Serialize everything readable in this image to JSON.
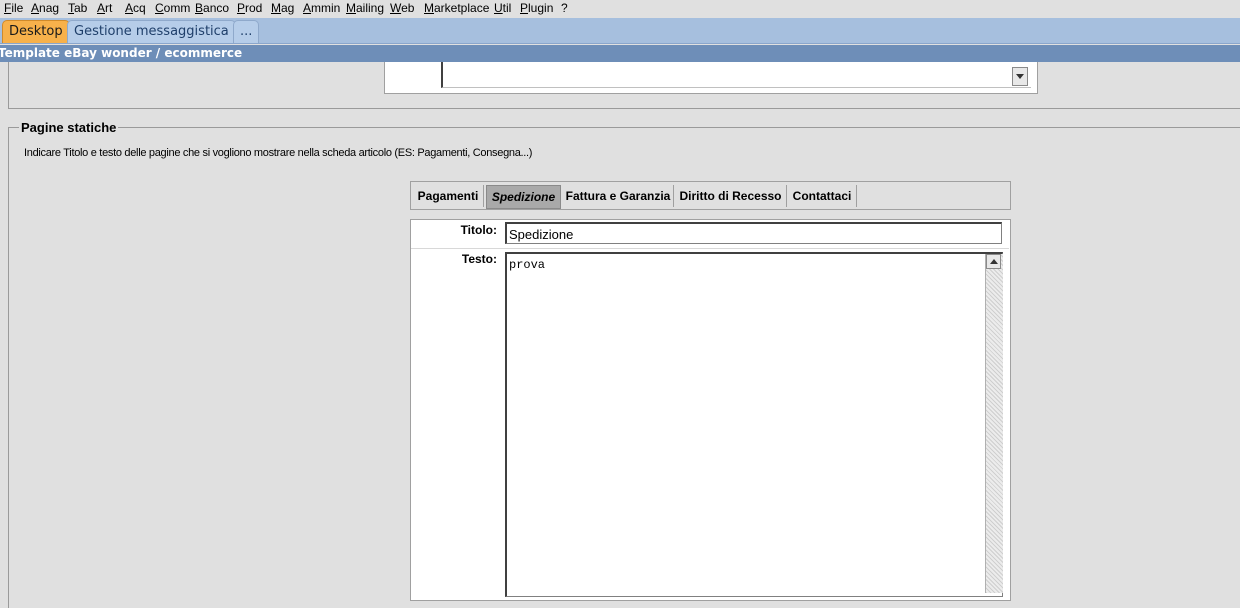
{
  "menu": [
    "File",
    "Anag",
    "Tab",
    "Art",
    "Acq",
    "Comm",
    "Banco",
    "Prod",
    "Mag",
    "Ammin",
    "Mailing",
    "Web",
    "Marketplace",
    "Util",
    "Plugin",
    "?"
  ],
  "window_tabs": {
    "desktop": "Desktop",
    "messaggistica": "Gestione messaggistica",
    "more": "..."
  },
  "title": "Template eBay wonder / ecommerce",
  "static_pages": {
    "heading": "Pagine statiche",
    "description": "Indicare Titolo e testo delle pagine che si vogliono mostrare nella scheda articolo (ES: Pagamenti, Consegna...)",
    "tabs": [
      "Pagamenti",
      "Spedizione",
      "Fattura e Garanzia",
      "Diritto di Recesso",
      "Contattaci"
    ],
    "selected_tab": "Spedizione",
    "titolo_label": "Titolo:",
    "titolo_value": "Spedizione",
    "testo_label": "Testo:",
    "testo_value": "prova"
  },
  "colors": {
    "active_tab": "#f7b14b",
    "title_bar": "#6e8eb8",
    "tab_bar": "#a6bfde"
  }
}
